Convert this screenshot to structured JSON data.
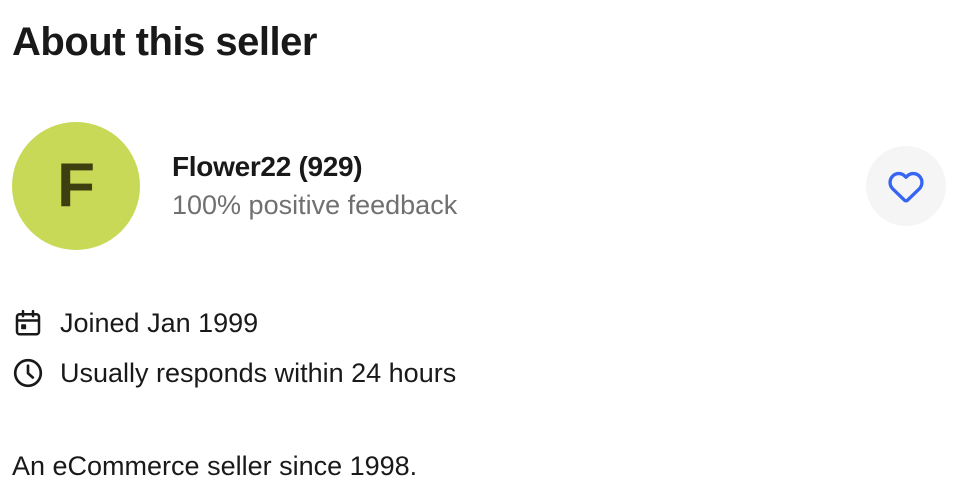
{
  "section": {
    "title": "About this seller"
  },
  "seller": {
    "avatar_letter": "F",
    "avatar_color": "#c8d957",
    "name_with_score": "Flower22 (929)",
    "feedback": "100% positive feedback",
    "save_icon": "heart-icon",
    "accent_color": "#3665f3"
  },
  "meta": {
    "joined": {
      "icon": "calendar-icon",
      "text": "Joined Jan 1999"
    },
    "responds": {
      "icon": "clock-icon",
      "text": "Usually responds within 24 hours"
    }
  },
  "bio": "An eCommerce seller since 1998."
}
